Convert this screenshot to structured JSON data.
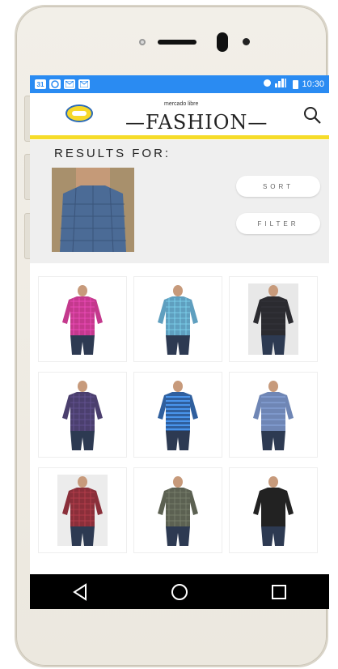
{
  "status_bar": {
    "left_icons": [
      "calendar-icon",
      "messenger-icon",
      "mail-icon",
      "mail-icon"
    ],
    "right_icons": [
      "alarm-icon",
      "signal-icon",
      "battery-icon"
    ],
    "time": "10:30",
    "calendar_label": "31"
  },
  "header": {
    "brand_small": "mercado libre",
    "brand_big": "—FASHION—",
    "colors": {
      "accent": "#f6dc2a",
      "status_bar": "#2a8bf2"
    }
  },
  "results": {
    "title": "RESULTS FOR:",
    "sort_label": "SORT",
    "filter_label": "FILTER"
  },
  "products": [
    {
      "shirt_color": "#c4398d",
      "pattern": "plaid",
      "background": "#ffffff"
    },
    {
      "shirt_color": "#5f9fbf",
      "pattern": "plaid",
      "background": "#ffffff"
    },
    {
      "shirt_color": "#2b2b30",
      "pattern": "print",
      "background": "#e8e8e8"
    },
    {
      "shirt_color": "#4b3f6e",
      "pattern": "plaid",
      "background": "#ffffff"
    },
    {
      "shirt_color": "#2f5f9e",
      "pattern": "stripes",
      "background": "#ffffff"
    },
    {
      "shirt_color": "#6f86b5",
      "pattern": "paisley",
      "background": "#ffffff"
    },
    {
      "shirt_color": "#8a2f3a",
      "pattern": "plaid",
      "background": "#ececec"
    },
    {
      "shirt_color": "#5c6152",
      "pattern": "plaid",
      "background": "#ffffff"
    },
    {
      "shirt_color": "#222222",
      "pattern": "solid",
      "background": "#ffffff"
    }
  ]
}
